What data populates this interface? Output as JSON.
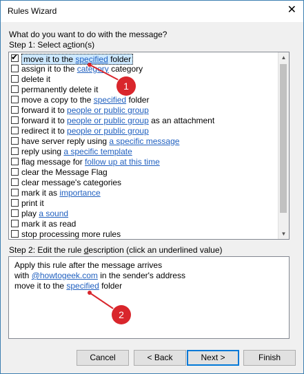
{
  "window": {
    "title": "Rules Wizard",
    "close_label": "✕"
  },
  "prompt": "What do you want to do with the message?",
  "step1": {
    "label_pre": "Step 1: Select a",
    "label_key": "c",
    "label_post": "tion(s)"
  },
  "actions": [
    {
      "checked": true,
      "pre": "move it to the ",
      "link": "specified",
      "post": " folder",
      "selected": true
    },
    {
      "checked": false,
      "pre": "assign it to the ",
      "link": "category",
      "post": " category"
    },
    {
      "checked": false,
      "pre": "delete it",
      "link": "",
      "post": ""
    },
    {
      "checked": false,
      "pre": "permanently delete it",
      "link": "",
      "post": ""
    },
    {
      "checked": false,
      "pre": "move a copy to the ",
      "link": "specified",
      "post": " folder"
    },
    {
      "checked": false,
      "pre": "forward it to ",
      "link": "people or public group",
      "post": ""
    },
    {
      "checked": false,
      "pre": "forward it to ",
      "link": "people or public group",
      "post": " as an attachment"
    },
    {
      "checked": false,
      "pre": "redirect it to ",
      "link": "people or public group",
      "post": ""
    },
    {
      "checked": false,
      "pre": "have server reply using ",
      "link": "a specific message",
      "post": ""
    },
    {
      "checked": false,
      "pre": "reply using ",
      "link": "a specific template",
      "post": ""
    },
    {
      "checked": false,
      "pre": "flag message for ",
      "link": "follow up at this time",
      "post": ""
    },
    {
      "checked": false,
      "pre": "clear the Message Flag",
      "link": "",
      "post": ""
    },
    {
      "checked": false,
      "pre": "clear message's categories",
      "link": "",
      "post": ""
    },
    {
      "checked": false,
      "pre": "mark it as ",
      "link": "importance",
      "post": ""
    },
    {
      "checked": false,
      "pre": "print it",
      "link": "",
      "post": ""
    },
    {
      "checked": false,
      "pre": "play ",
      "link": "a sound",
      "post": ""
    },
    {
      "checked": false,
      "pre": "mark it as read",
      "link": "",
      "post": ""
    },
    {
      "checked": false,
      "pre": "stop processing more rules",
      "link": "",
      "post": ""
    }
  ],
  "step2": {
    "label_pre": "Step 2: Edit the rule ",
    "label_key": "d",
    "label_post": "escription (click an underlined value)"
  },
  "description": [
    {
      "pre": "Apply this rule after the message arrives",
      "link": "",
      "post": ""
    },
    {
      "pre": "with ",
      "link": "@howtogeek.com",
      "post": " in the sender's address"
    },
    {
      "pre": "move it to the ",
      "link": "specified",
      "post": " folder"
    }
  ],
  "buttons": {
    "cancel": "Cancel",
    "back": "< Back",
    "next": "Next >",
    "finish": "Finish"
  },
  "annotations": {
    "badge1": "1",
    "badge2": "2",
    "color": "#d9262c"
  }
}
